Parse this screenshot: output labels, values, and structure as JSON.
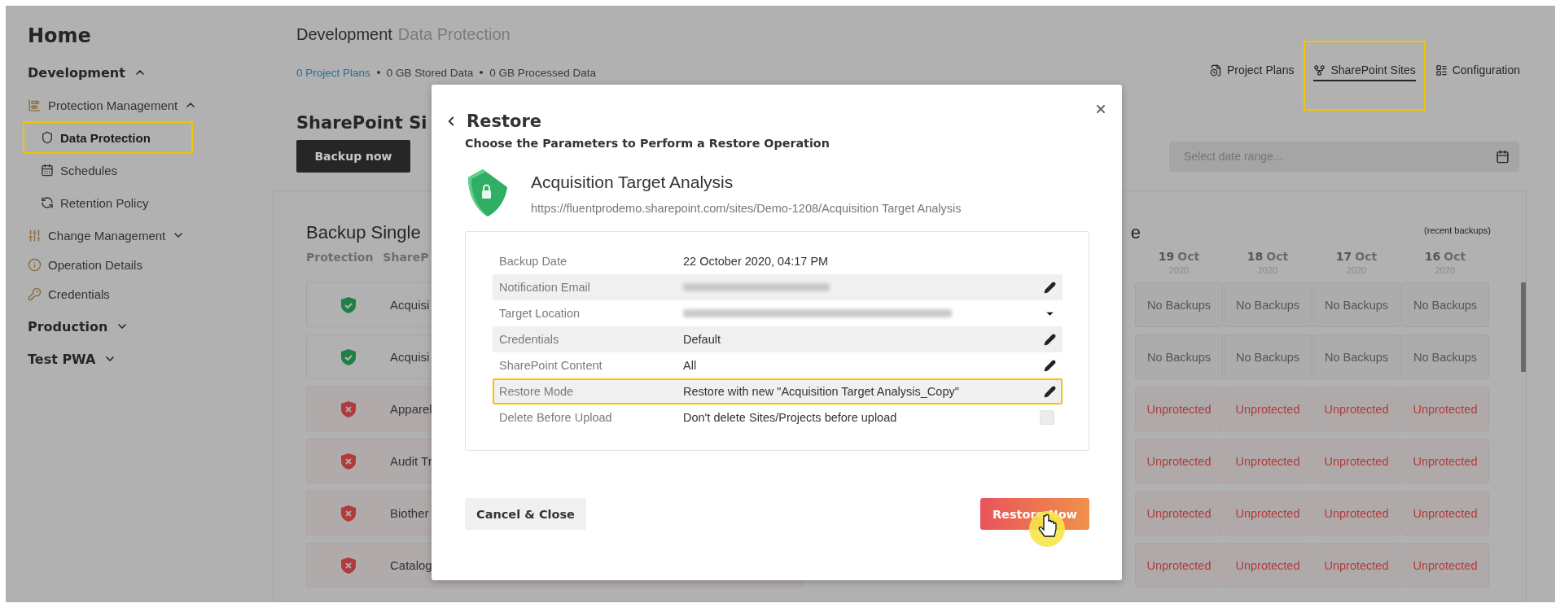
{
  "sidebar": {
    "title": "Home",
    "items": [
      {
        "label": "Development",
        "selected": false,
        "expanded": true,
        "children": [
          {
            "label": "Protection Management",
            "selected": false,
            "expanded": true,
            "children": [
              {
                "label": "Data Protection",
                "selected": true,
                "highlighted": true
              },
              {
                "label": "Schedules",
                "selected": false,
                "highlighted": false
              },
              {
                "label": "Retention Policy",
                "selected": false,
                "highlighted": false
              }
            ]
          },
          {
            "label": "Change Management",
            "selected": false,
            "expanded": false
          },
          {
            "label": "Operation Details",
            "selected": false
          },
          {
            "label": "Credentials",
            "selected": false
          }
        ]
      },
      {
        "label": "Production",
        "selected": false,
        "expanded": false
      },
      {
        "label": "Test PWA",
        "selected": false,
        "expanded": false
      }
    ]
  },
  "header": {
    "title": "Development",
    "subtitle": "Data Protection",
    "stats": [
      {
        "text": "0 Project Plans",
        "kind": "link"
      },
      {
        "text": "0 GB Stored Data",
        "kind": "plain"
      },
      {
        "text": "0 GB Processed Data",
        "kind": "plain"
      }
    ],
    "nav": [
      {
        "label": "Project Plans",
        "selected": false,
        "highlighted": false
      },
      {
        "label": "SharePoint Sites",
        "selected": true,
        "highlighted": true
      },
      {
        "label": "Configuration",
        "selected": false,
        "highlighted": false
      }
    ]
  },
  "section_title": "SharePoint Si",
  "backup_button": "Backup now",
  "date_range": {
    "placeholder": "Select date range..."
  },
  "table": {
    "title": "Backup Single",
    "title_end": "e",
    "note": "(recent backups)",
    "columns": [
      "Protection",
      "ShareP"
    ],
    "dates": [
      {
        "day": "19",
        "month": "Oct",
        "year": "2020"
      },
      {
        "day": "18",
        "month": "Oct",
        "year": "2020"
      },
      {
        "day": "17",
        "month": "Oct",
        "year": "2020"
      },
      {
        "day": "16",
        "month": "Oct",
        "year": "2020"
      }
    ],
    "rows": [
      {
        "name": "Acquisi",
        "kind": "protected",
        "cells": [
          {
            "text": "No Backups",
            "kind": "none"
          },
          {
            "text": "No Backups",
            "kind": "none"
          },
          {
            "text": "No Backups",
            "kind": "none"
          },
          {
            "text": "No Backups",
            "kind": "none"
          }
        ]
      },
      {
        "name": "Acquisi",
        "kind": "protected",
        "cells": [
          {
            "text": "No Backups",
            "kind": "none"
          },
          {
            "text": "No Backups",
            "kind": "none"
          },
          {
            "text": "No Backups",
            "kind": "none"
          },
          {
            "text": "No Backups",
            "kind": "none"
          }
        ]
      },
      {
        "name": "Apparel",
        "kind": "unprotected",
        "cells": [
          {
            "text": "Unprotected",
            "kind": "unprotected"
          },
          {
            "text": "Unprotected",
            "kind": "unprotected"
          },
          {
            "text": "Unprotected",
            "kind": "unprotected"
          },
          {
            "text": "Unprotected",
            "kind": "unprotected"
          }
        ]
      },
      {
        "name": "Audit Tr",
        "kind": "unprotected",
        "cells": [
          {
            "text": "Unprotected",
            "kind": "unprotected"
          },
          {
            "text": "Unprotected",
            "kind": "unprotected"
          },
          {
            "text": "Unprotected",
            "kind": "unprotected"
          },
          {
            "text": "Unprotected",
            "kind": "unprotected"
          }
        ]
      },
      {
        "name": "Biother",
        "kind": "unprotected",
        "cells": [
          {
            "text": "Unprotected",
            "kind": "unprotected"
          },
          {
            "text": "Unprotected",
            "kind": "unprotected"
          },
          {
            "text": "Unprotected",
            "kind": "unprotected"
          },
          {
            "text": "Unprotected",
            "kind": "unprotected"
          }
        ]
      },
      {
        "name": "Catalog",
        "kind": "unprotected",
        "cells": [
          {
            "text": "Unprotected",
            "kind": "unprotected"
          },
          {
            "text": "Unprotected",
            "kind": "unprotected"
          },
          {
            "text": "Unprotected",
            "kind": "unprotected"
          },
          {
            "text": "Unprotected",
            "kind": "unprotected"
          }
        ]
      }
    ]
  },
  "dialog": {
    "title": "Restore",
    "subtitle": "Choose the Parameters to Perform a Restore Operation",
    "site": {
      "name": "Acquisition Target Analysis",
      "url": "https://fluentprodemo.sharepoint.com/sites/Demo-1208/Acquisition Target Analysis"
    },
    "params": [
      {
        "label": "Backup Date",
        "value": "22 October 2020, 04:17 PM",
        "kind": "plain",
        "highlighted": false
      },
      {
        "label": "Notification Email",
        "kind": "edit",
        "highlighted": false
      },
      {
        "label": "Target Location",
        "kind": "dropdown",
        "highlighted": false
      },
      {
        "label": "Credentials",
        "value": "Default",
        "kind": "edit",
        "highlighted": false
      },
      {
        "label": "SharePoint Content",
        "value": "All",
        "kind": "edit",
        "highlighted": false
      },
      {
        "label": "Restore Mode",
        "value": "Restore with new \"Acquisition Target Analysis_Copy\"",
        "kind": "edit",
        "highlighted": true
      },
      {
        "label": "Delete Before Upload",
        "value": "Don't delete Sites/Projects before upload",
        "kind": "checkbox",
        "checked": false,
        "highlighted": false
      }
    ],
    "buttons": [
      {
        "label": "Cancel & Close",
        "kind": "secondary"
      },
      {
        "label": "Restore Now",
        "kind": "primary"
      }
    ]
  }
}
